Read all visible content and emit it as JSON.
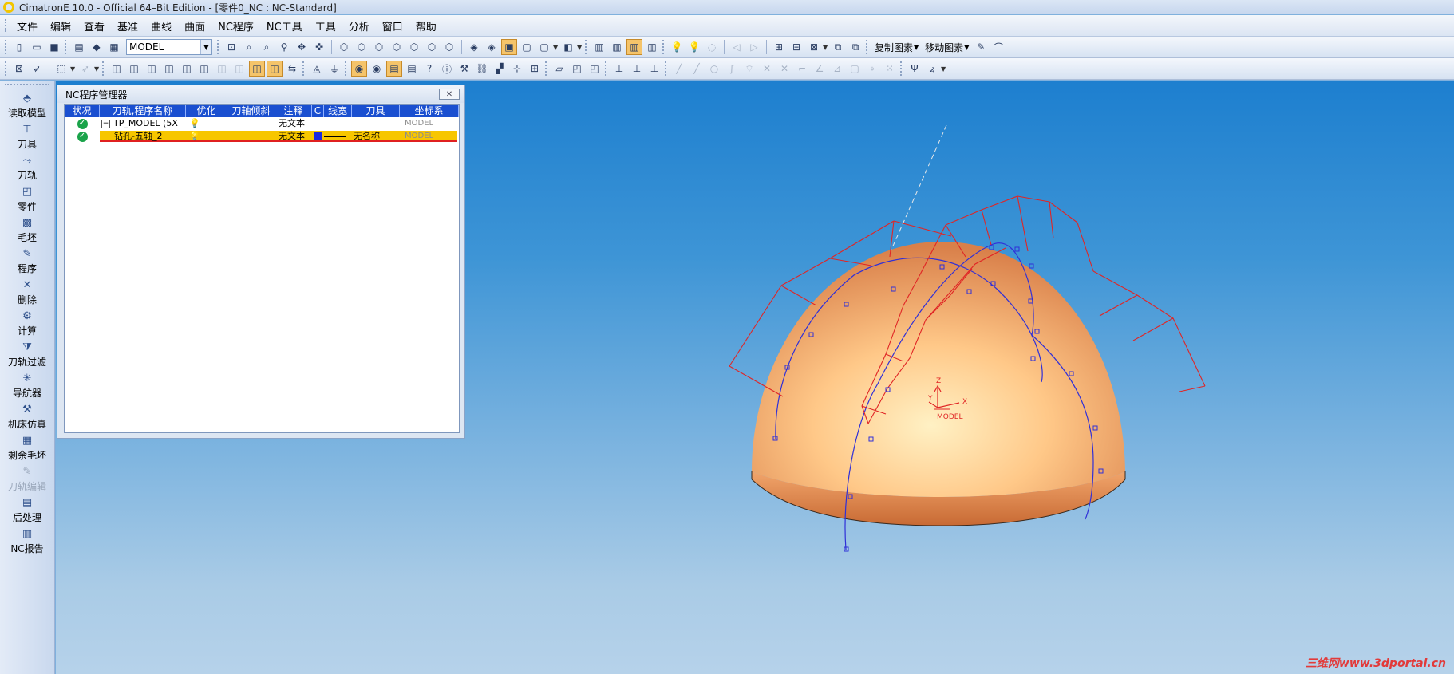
{
  "window": {
    "title": "CimatronE 10.0 - Official 64–Bit Edition - [零件0_NC : NC-Standard]"
  },
  "menubar": [
    "文件",
    "编辑",
    "查看",
    "基准",
    "曲线",
    "曲面",
    "NC程序",
    "NC工具",
    "工具",
    "分析",
    "窗口",
    "帮助"
  ],
  "toolbar1": {
    "model_combo": "MODEL",
    "copy_entity": "复制图素",
    "move_entity": "移动图素"
  },
  "leftbar": [
    {
      "label": "读取模型",
      "icon": "load-model-icon"
    },
    {
      "label": "刀具",
      "icon": "tool-icon"
    },
    {
      "label": "刀轨",
      "icon": "toolpath-icon"
    },
    {
      "label": "零件",
      "icon": "part-icon"
    },
    {
      "label": "毛坯",
      "icon": "stock-icon"
    },
    {
      "label": "程序",
      "icon": "program-icon"
    },
    {
      "label": "删除",
      "icon": "delete-icon"
    },
    {
      "label": "计算",
      "icon": "compute-icon"
    },
    {
      "label": "刀轨过滤",
      "icon": "toolpath-filter-icon"
    },
    {
      "label": "导航器",
      "icon": "navigator-icon"
    },
    {
      "label": "机床仿真",
      "icon": "machine-sim-icon"
    },
    {
      "label": "剩余毛坯",
      "icon": "remaining-stock-icon"
    },
    {
      "label": "刀轨编辑",
      "icon": "toolpath-edit-icon",
      "disabled": true
    },
    {
      "label": "后处理",
      "icon": "post-process-icon"
    },
    {
      "label": "NC报告",
      "icon": "nc-report-icon"
    }
  ],
  "nc_panel": {
    "title": "NC程序管理器",
    "columns": [
      "状况",
      "刀轨,程序名称",
      "优化",
      "刀轴倾斜",
      "注释",
      "C",
      "线宽",
      "刀具",
      "坐标系"
    ],
    "rows": [
      {
        "name": "TP_MODEL (5X",
        "note": "无文本",
        "tool": "",
        "coord": "MODEL",
        "selected": false
      },
      {
        "name": "钻孔-五轴_2",
        "note": "无文本",
        "tool": "无名称",
        "coord": "MODEL",
        "selected": true
      }
    ]
  },
  "viewport": {
    "axis_labels": {
      "z": "Z",
      "y": "Y",
      "x": "X",
      "model": "MODEL"
    },
    "colors": {
      "dome": "#f5b27a",
      "path": "#2f2fd8",
      "frame": "#e02525"
    }
  },
  "watermark": "三维网www.3dportal.cn"
}
